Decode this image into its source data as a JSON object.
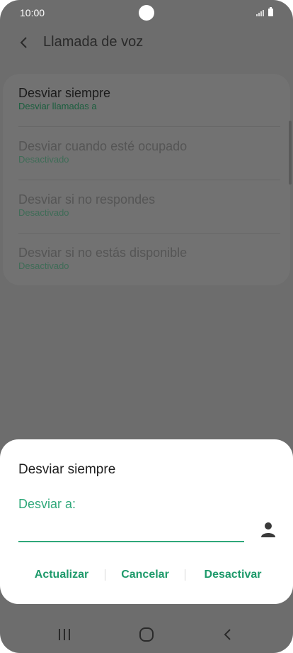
{
  "status_bar": {
    "time": "10:00"
  },
  "header": {
    "title": "Llamada de voz"
  },
  "settings": [
    {
      "label": "Desviar siempre",
      "sub": "Desviar llamadas a",
      "state": "active"
    },
    {
      "label": "Desviar cuando esté ocupado",
      "sub": "Desactivado",
      "state": "disabled"
    },
    {
      "label": "Desviar si no respondes",
      "sub": "Desactivado",
      "state": "disabled"
    },
    {
      "label": "Desviar si no estás disponible",
      "sub": "Desactivado",
      "state": "disabled"
    }
  ],
  "dialog": {
    "title": "Desviar siempre",
    "field_label": "Desviar a:",
    "field_value": "",
    "buttons": {
      "update": "Actualizar",
      "cancel": "Cancelar",
      "deactivate": "Desactivar"
    }
  },
  "icons": {
    "back": "chevron-left-icon",
    "contact": "person-icon",
    "nav_recents": "recents-icon",
    "nav_home": "home-icon",
    "nav_back": "back-icon"
  },
  "colors": {
    "accent": "#2fa87a",
    "scrim": "#6d6d6d",
    "dialog": "#ffffff"
  }
}
